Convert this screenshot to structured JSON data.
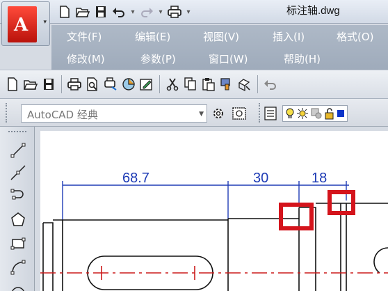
{
  "window": {
    "title": "标注轴.dwg"
  },
  "menu": {
    "row1": [
      "文件(F)",
      "编辑(E)",
      "视图(V)",
      "插入(I)",
      "格式(O)"
    ],
    "row2": [
      "修改(M)",
      "参数(P)",
      "窗口(W)",
      "帮助(H)"
    ]
  },
  "workspace": {
    "selected": "AutoCAD 经典"
  },
  "drawing": {
    "dimensions": [
      "68.7",
      "30",
      "18"
    ],
    "colors": {
      "dimension": "#1e3bb5",
      "centerline": "#cc1a1a",
      "highlight": "#d4141c",
      "outline": "#111111"
    }
  }
}
